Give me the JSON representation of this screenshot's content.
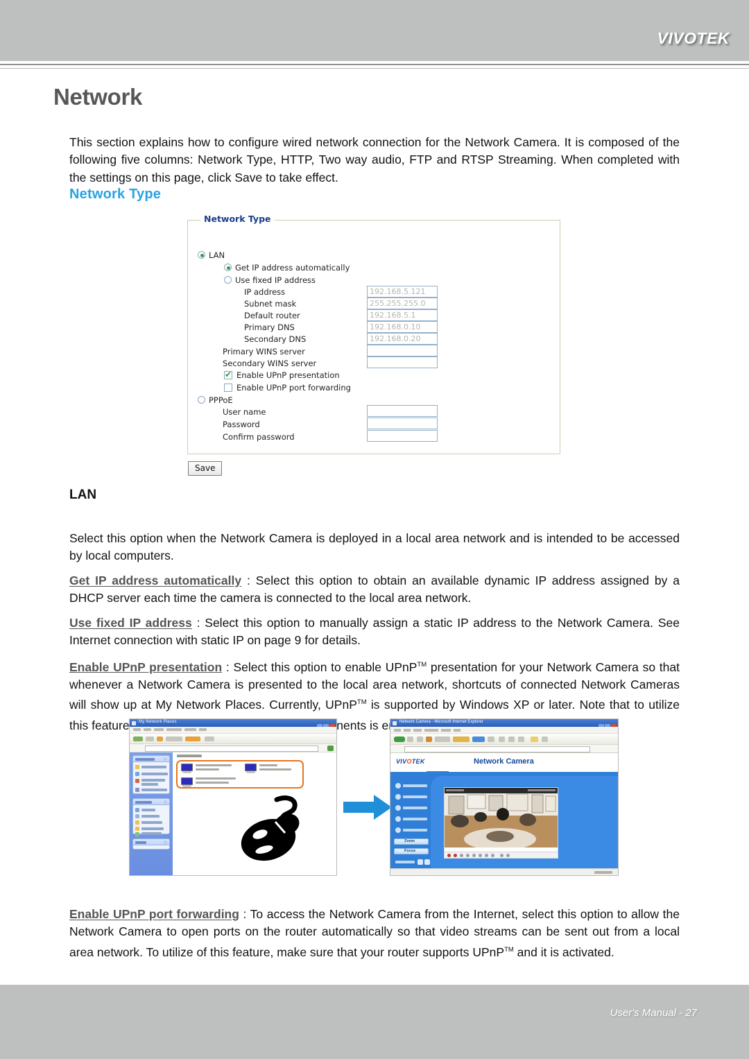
{
  "header": {
    "brand": "VIVOTEK"
  },
  "footer": {
    "text": "User's Manual - 27"
  },
  "page": {
    "title": "Network",
    "intro": "This section explains how to configure wired network connection for the Network Camera. It is composed of the following five columns: Network Type, HTTP, Two way audio, FTP and RTSP Streaming. When completed with the settings on this page, click Save to take effect.",
    "section_title": "Network Type",
    "sub_title": "LAN",
    "lan_desc": "Select this option when the Network Camera is deployed in a local area network and is intended to be accessed by local computers.",
    "terms": {
      "get_ip": "Get IP address automatically",
      "fixed_ip": "Use fixed IP address",
      "upnp_presentation": "Enable UPnP presentation",
      "upnp_forwarding": "Enable UPnP port forwarding"
    },
    "get_ip_desc": ": Select this option to obtain an available dynamic IP address assigned by a DHCP server each time the camera is connected to the local area network.",
    "fixed_ip_desc": ": Select this option to manually assign a static IP address to the Network Camera. See Internet connection with static IP on page 9 for details.",
    "upnp_presentation_desc_1": ": Select this option to enable UPnP",
    "upnp_presentation_desc_2": " presentation for your Network Camera so that whenever a Network Camera is presented to the local area network, shortcuts of connected Network Cameras will show up at My Network Places. Currently, UPnP",
    "upnp_presentation_desc_3": " is supported by Windows XP or later. Note that to utilize this feature, please make sure the UPnP",
    "upnp_presentation_desc_4": " components is enabled on your computer.",
    "upnp_forwarding_desc_1": ": To access the Network Camera from the Internet, select this option to allow the Network Camera to open ports on the router automatically so that video streams can be sent out from a local area network. To utilize of this feature, make sure that your router supports UPnP",
    "upnp_forwarding_desc_2": " and it is activated.",
    "tm": "TM"
  },
  "form": {
    "legend": "Network Type",
    "lan_label": "LAN",
    "lan_selected": true,
    "get_ip_label": "Get IP address automatically",
    "get_ip_selected": true,
    "fixed_ip_label": "Use fixed IP address",
    "fixed_ip_selected": false,
    "fields": [
      {
        "label": "IP address",
        "value": "192.168.5.121"
      },
      {
        "label": "Subnet mask",
        "value": "255.255.255.0"
      },
      {
        "label": "Default router",
        "value": "192.168.5.1"
      },
      {
        "label": "Primary DNS",
        "value": "192.168.0.10"
      },
      {
        "label": "Secondary DNS",
        "value": "192.168.0.20"
      },
      {
        "label": "Primary WINS server",
        "value": ""
      },
      {
        "label": "Secondary WINS server",
        "value": ""
      }
    ],
    "upnp_presentation_label": "Enable UPnP presentation",
    "upnp_presentation_checked": true,
    "upnp_forwarding_label": "Enable UPnP port forwarding",
    "upnp_forwarding_checked": false,
    "pppoe_label": "PPPoE",
    "pppoe_selected": false,
    "pppoe_fields": [
      {
        "label": "User name",
        "value": ""
      },
      {
        "label": "Password",
        "value": ""
      },
      {
        "label": "Confirm password",
        "value": ""
      }
    ],
    "save_label": "Save"
  },
  "illustrations": {
    "xp_window": {
      "title": "My Network Places",
      "content_header": "Local Network"
    },
    "camera_window": {
      "title": "Network Camera - Microsoft Internet Explorer",
      "brand_1": "VIV",
      "brand_2": "O",
      "brand_3": "TEK",
      "heading": "Network Camera",
      "buttons": [
        "Zoom",
        "Focus"
      ]
    }
  },
  "colors": {
    "header_gray": "#bec0c0",
    "accent_blue": "#29a3e0",
    "legend_blue": "#1a3c8c",
    "arrow_blue": "#1f8fd8",
    "highlight_orange": "#e8751a",
    "check_green": "#2e9b44"
  }
}
